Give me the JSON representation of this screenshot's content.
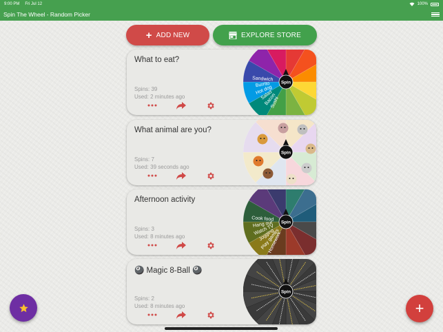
{
  "status_bar": {
    "time": "9:00 PM",
    "date": "Fri Jul 12",
    "battery": "100%"
  },
  "app_bar": {
    "title": "Spin The Wheel - Random Picker"
  },
  "buttons": {
    "add_new": "ADD NEW",
    "explore_store": "EXPLORE STORE"
  },
  "colors": {
    "green": "#46a04f",
    "red": "#d04a48",
    "purple": "#6e2ea3",
    "card": "#e9e9e6"
  },
  "wheels": [
    {
      "title": "What to eat?",
      "spins": "Spins: 39",
      "used": "Used: 2 minutes ago",
      "segment_colors": [
        "#e53935",
        "#f4511e",
        "#fb8c00",
        "#fdd835",
        "#c0ca33",
        "#7cb342",
        "#43a047",
        "#00897b",
        "#039be5",
        "#3949ab",
        "#8e24aa",
        "#d81b60"
      ],
      "labels": [
        "Sushi",
        "Bacon",
        "Salad",
        "Hot dog",
        "Burrito",
        "Sandwich"
      ]
    },
    {
      "title": "What animal are you?",
      "spins": "Spins: 7",
      "used": "Used: 39 seconds ago",
      "segment_colors": [
        "#f5e6c8",
        "#e8d7f0",
        "#d7ebd4",
        "#f7d7dc",
        "#dfe6f0",
        "#f3eacb",
        "#e6dcef",
        "#f6dfd0"
      ],
      "labels": []
    },
    {
      "title": "Afternoon activity",
      "spins": "Spins: 3",
      "used": "Used: 8 minutes ago",
      "segment_colors": [
        "#2e7d6e",
        "#3c6e8f",
        "#1f5c7a",
        "#4a4a4a",
        "#7a2e2e",
        "#9c3a2a",
        "#6a3c1f",
        "#8a7a1a",
        "#5f6e1f",
        "#2d5e3b",
        "#5b3a7a",
        "#3b3b6e"
      ],
      "labels": [
        "Homework",
        "Play games",
        "Jogging",
        "Watch TV",
        "Hang out",
        "Cook food"
      ]
    },
    {
      "title": "🎱 Magic 8-Ball 🎱",
      "spins": "Spins: 2",
      "used": "Used: 8 minutes ago",
      "segment_colors": [
        "#3a3a3a",
        "#444444"
      ],
      "labels": []
    }
  ],
  "spin_label": "Spin",
  "icons": {
    "more": "more-icon",
    "share": "share-icon",
    "settings": "gear-icon",
    "favorite": "star-icon",
    "add": "plus-icon",
    "store": "store-icon",
    "menu": "menu-icon"
  },
  "fab_add_glyph": "+"
}
